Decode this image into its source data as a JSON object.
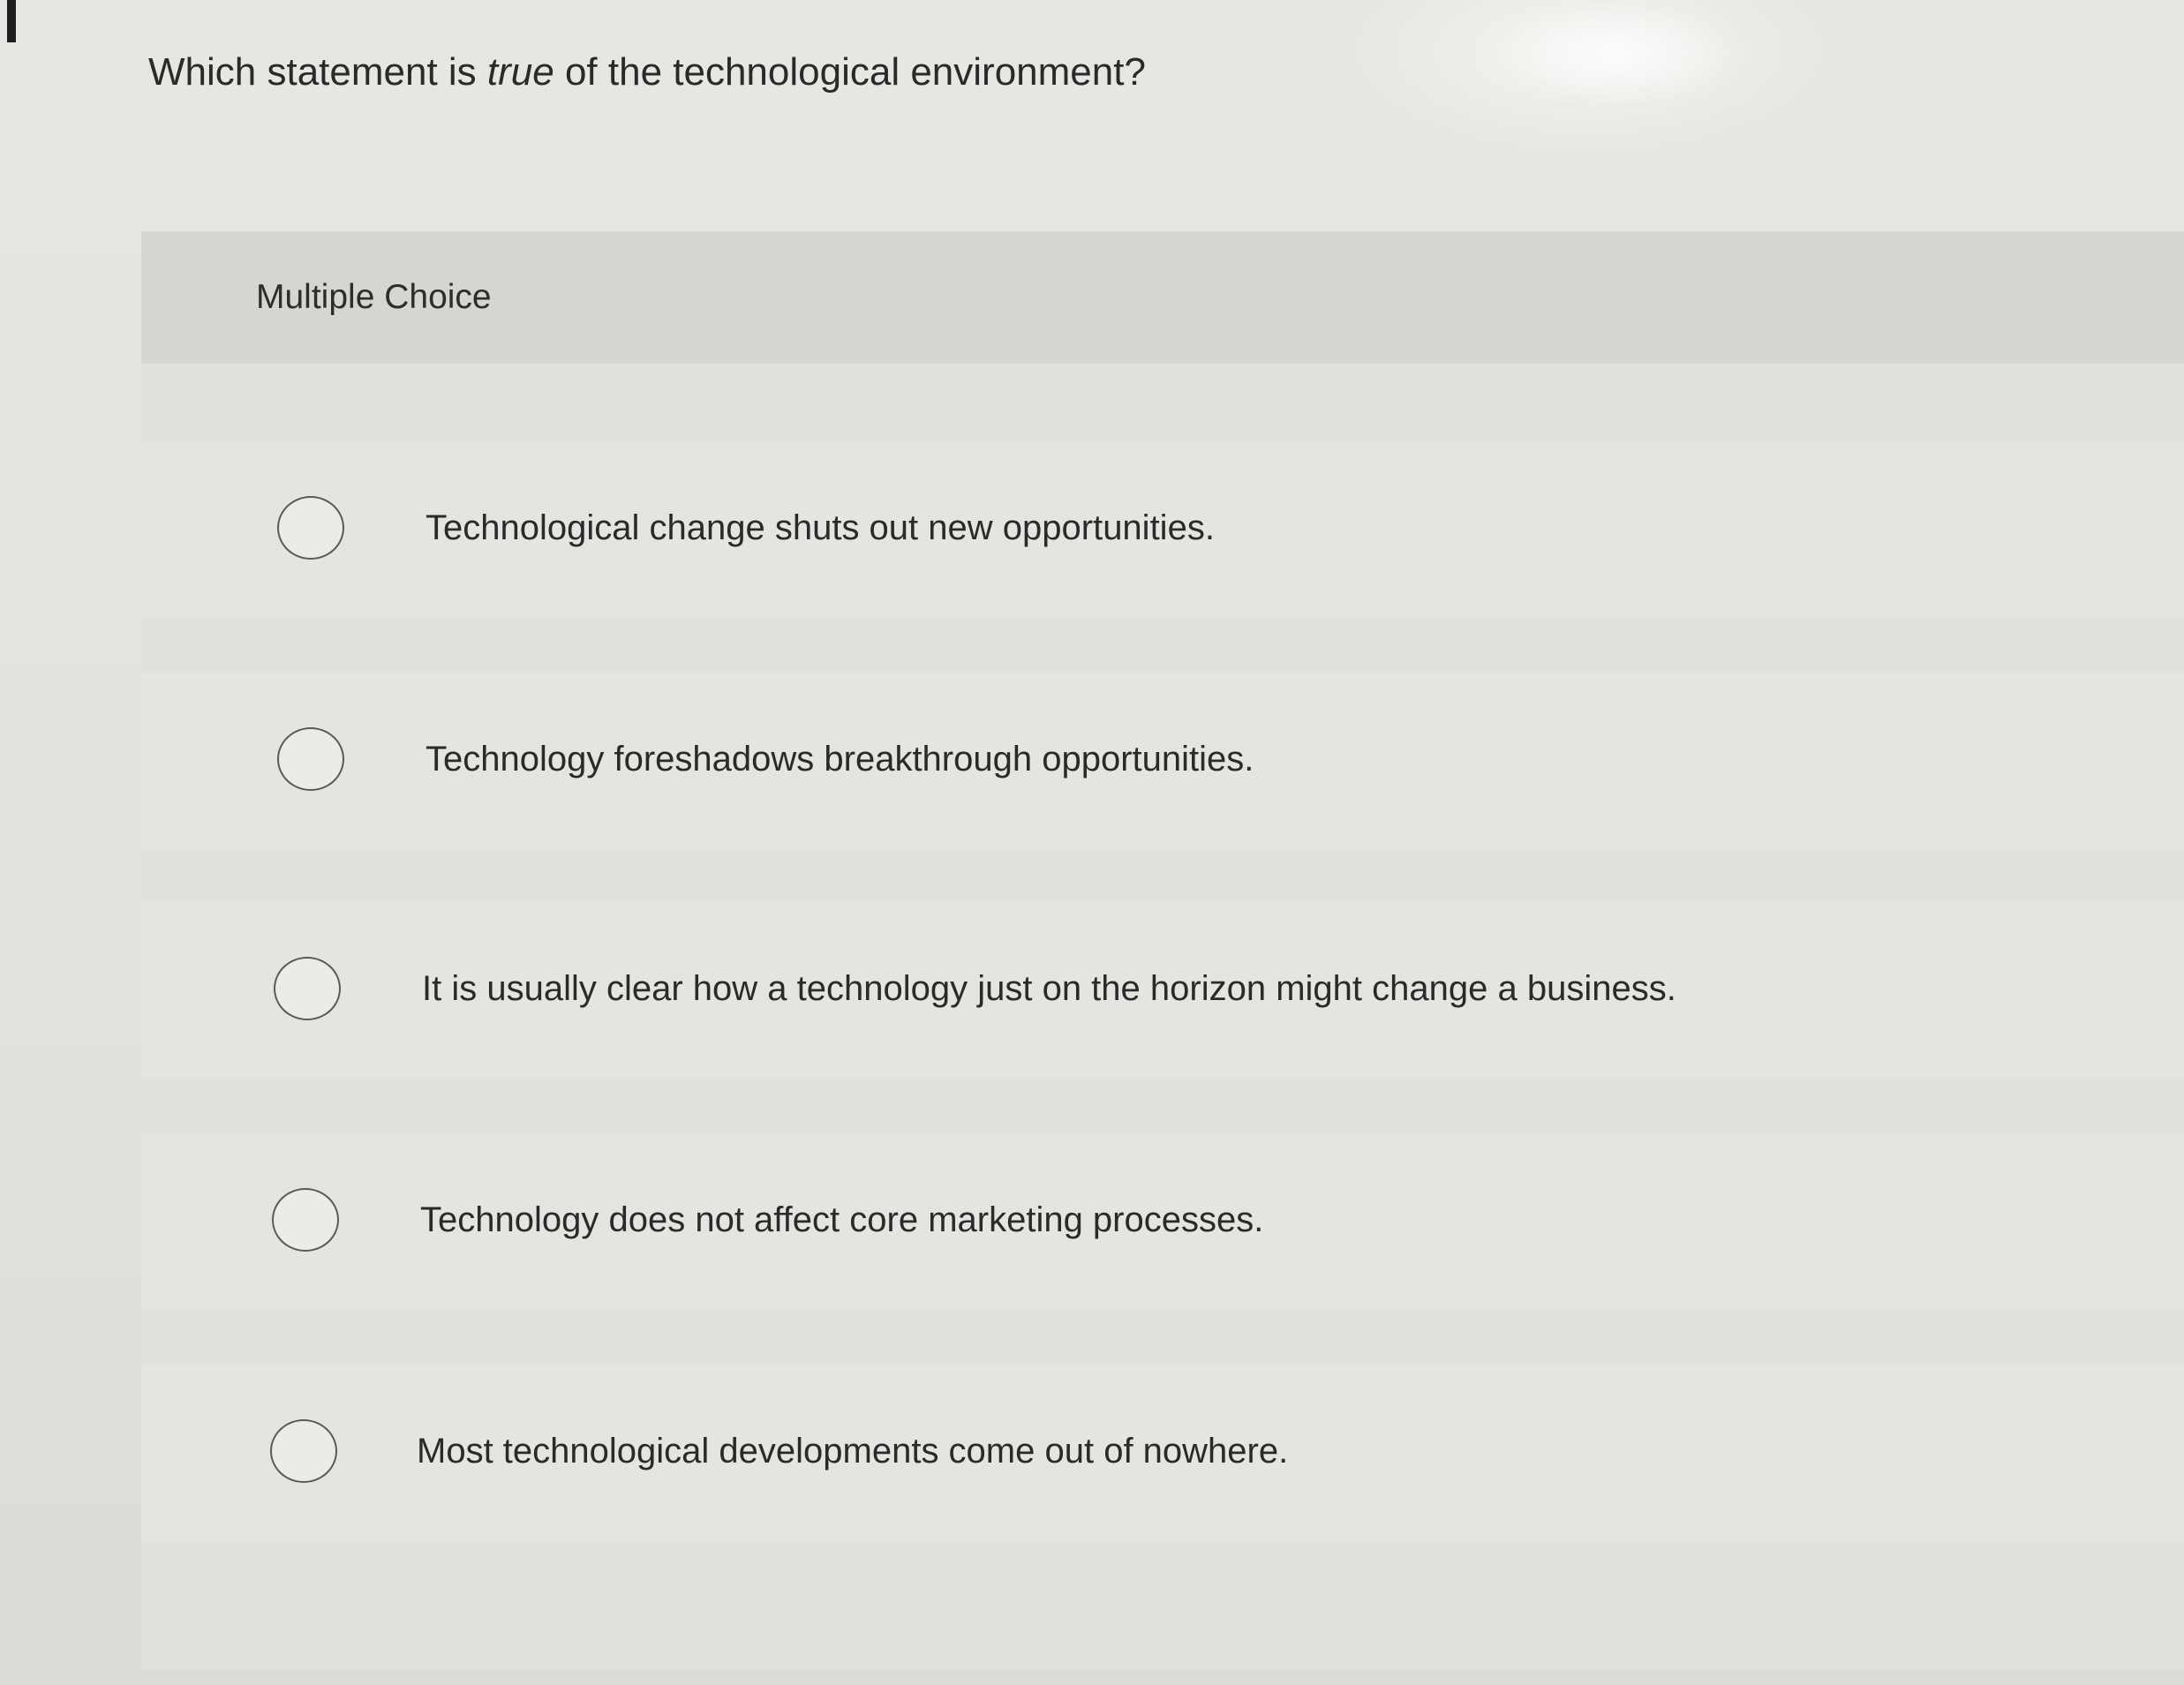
{
  "question": {
    "before": "Which statement is ",
    "emphasis": "true",
    "after": " of the technological environment?"
  },
  "section_label": "Multiple Choice",
  "options": [
    {
      "label": "Technological change shuts out new opportunities.",
      "selected": false
    },
    {
      "label": "Technology foreshadows breakthrough opportunities.",
      "selected": false
    },
    {
      "label": "It is usually clear how a technology just on the horizon might change a business.",
      "selected": false
    },
    {
      "label": "Technology does not affect core marketing processes.",
      "selected": false
    },
    {
      "label": "Most technological developments come out of nowhere.",
      "selected": false
    }
  ],
  "colors": {
    "background": "#e4e3df",
    "panel": "#d9d8d4",
    "text": "#2a2a2a",
    "radio_border": "#5a5a5a"
  }
}
